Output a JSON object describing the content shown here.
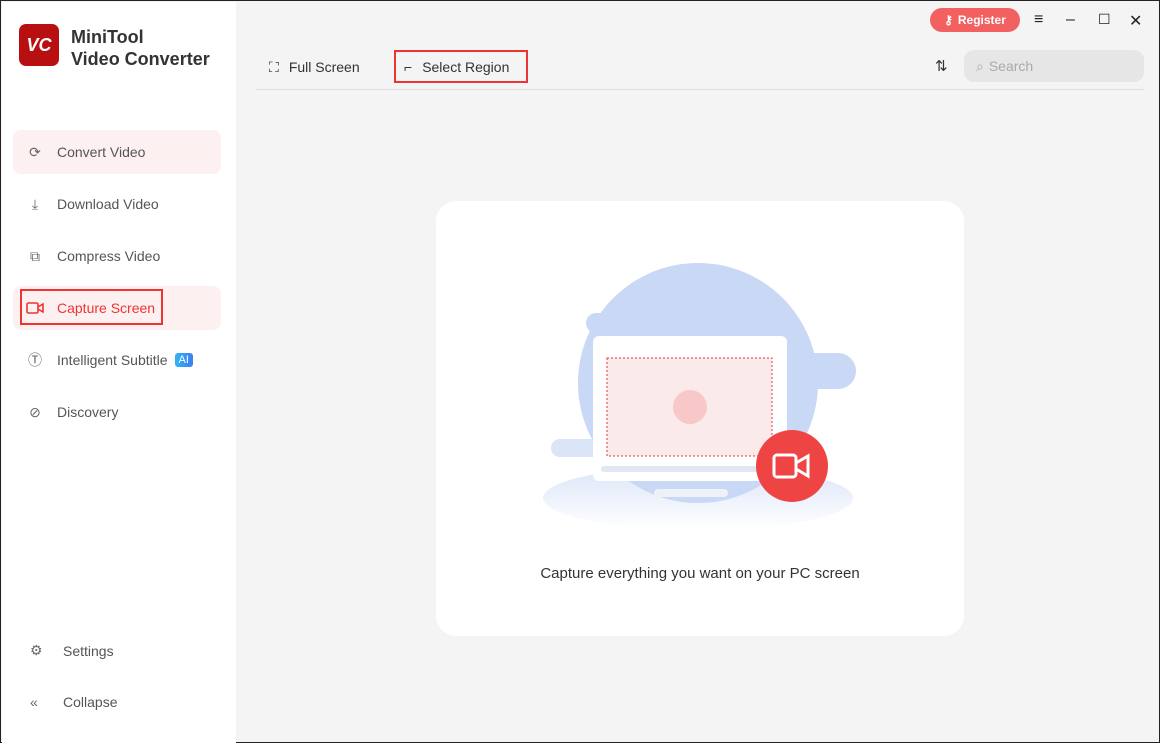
{
  "app": {
    "name_line1": "MiniTool",
    "name_line2": "Video Converter",
    "logo_text": "VC"
  },
  "sidebar": {
    "items": [
      {
        "label": "Convert Video",
        "icon": "convert-icon"
      },
      {
        "label": "Download Video",
        "icon": "download-icon"
      },
      {
        "label": "Compress Video",
        "icon": "compress-icon"
      },
      {
        "label": "Capture Screen",
        "icon": "camera-icon"
      },
      {
        "label": "Intelligent Subtitle",
        "icon": "subtitle-icon",
        "badge": "AI"
      },
      {
        "label": "Discovery",
        "icon": "compass-icon"
      }
    ],
    "settings": "Settings",
    "collapse": "Collapse"
  },
  "titlebar": {
    "register": "Register"
  },
  "toolbar": {
    "full_screen": "Full Screen",
    "select_region": "Select Region",
    "search_placeholder": "Search"
  },
  "main": {
    "caption": "Capture everything you want on your PC screen"
  },
  "colors": {
    "accent": "#ee3333",
    "illustration_blue": "#c9d8f5"
  }
}
